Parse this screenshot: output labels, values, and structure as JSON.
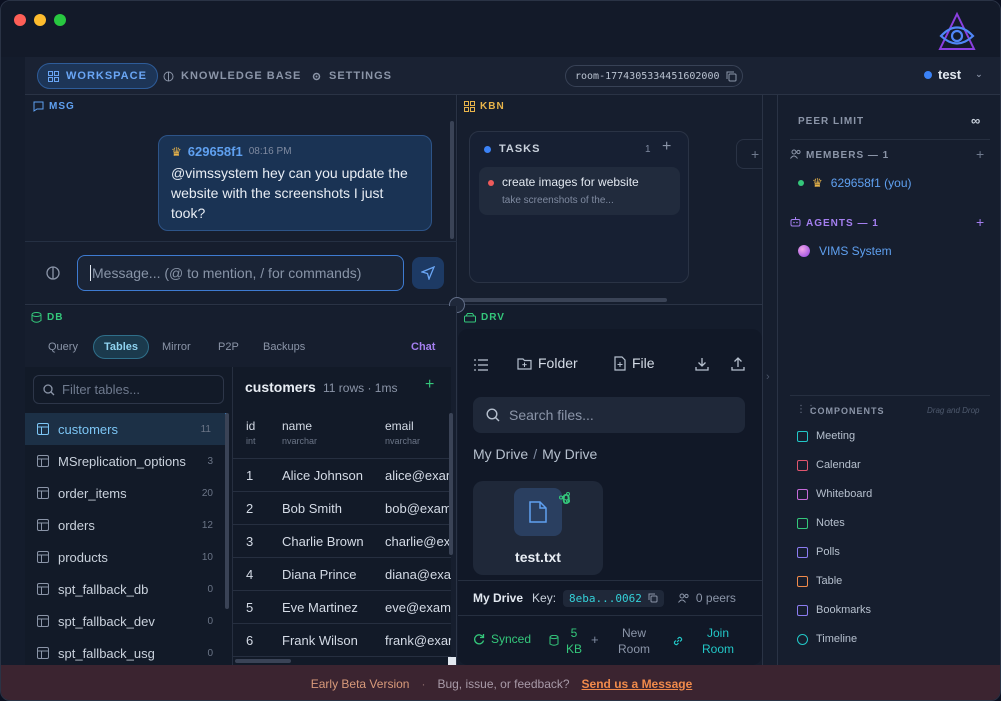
{
  "nav": {
    "workspace": "WORKSPACE",
    "knowledge": "KNOWLEDGE BASE",
    "settings": "SETTINGS",
    "room_id": "room-1774305334451602000",
    "user": "test"
  },
  "msg": {
    "header": "MSG",
    "author": "629658f1",
    "time": "08:16 PM",
    "text": "@vimssystem hey can you update the website with the screenshots I just took?",
    "placeholder": "Message... (@ to mention, / for commands)"
  },
  "kbn": {
    "header": "KBN",
    "column": "TASKS",
    "count": "1",
    "task_title": "create images for website",
    "task_desc": "take screenshots of the..."
  },
  "db": {
    "header": "DB",
    "tabs": [
      "Query",
      "Tables",
      "Mirror",
      "P2P",
      "Backups"
    ],
    "chat": "Chat",
    "filter_placeholder": "Filter tables...",
    "tables": [
      {
        "name": "customers",
        "count": "11"
      },
      {
        "name": "MSreplication_options",
        "count": "3"
      },
      {
        "name": "order_items",
        "count": "20"
      },
      {
        "name": "orders",
        "count": "12"
      },
      {
        "name": "products",
        "count": "10"
      },
      {
        "name": "spt_fallback_db",
        "count": "0"
      },
      {
        "name": "spt_fallback_dev",
        "count": "0"
      },
      {
        "name": "spt_fallback_usg",
        "count": "0"
      }
    ],
    "grid_title": "customers",
    "grid_meta": "11 rows · 1ms",
    "columns": [
      {
        "name": "id",
        "type": "int"
      },
      {
        "name": "name",
        "type": "nvarchar"
      },
      {
        "name": "email",
        "type": "nvarchar"
      }
    ],
    "rows": [
      [
        "1",
        "Alice Johnson",
        "alice@exan"
      ],
      [
        "2",
        "Bob Smith",
        "bob@exam"
      ],
      [
        "3",
        "Charlie Brown",
        "charlie@ex"
      ],
      [
        "4",
        "Diana Prince",
        "diana@exar"
      ],
      [
        "5",
        "Eve Martinez",
        "eve@examp"
      ],
      [
        "6",
        "Frank Wilson",
        "frank@exar"
      ]
    ]
  },
  "drv": {
    "header": "DRV",
    "folder": "Folder",
    "file": "File",
    "search_placeholder": "Search files...",
    "breadcrumb_root": "My Drive",
    "breadcrumb_sep": "/",
    "breadcrumb_current": "My Drive",
    "file_name": "test.txt",
    "share_count": "0",
    "drive_label": "My Drive",
    "key_label": "Key:",
    "key": "8eba...0062",
    "peers": "0 peers",
    "synced": "Synced",
    "size": "5",
    "size_unit": "KB",
    "new_room": "New",
    "new_room2": "Room",
    "join_room": "Join",
    "join_room2": "Room"
  },
  "right": {
    "peer_limit": "PEER LIMIT",
    "infinity": "∞",
    "members": "MEMBERS — 1",
    "member": "629658f1 (you)",
    "agents": "AGENTS — 1",
    "agent": "VIMS System",
    "components": "COMPONENTS",
    "drag": "Drag and Drop",
    "items": [
      "Meeting",
      "Calendar",
      "Whiteboard",
      "Notes",
      "Polls",
      "Table",
      "Bookmarks",
      "Timeline"
    ],
    "item_colors": [
      "#22c7c7",
      "#e0566f",
      "#c56bd9",
      "#34c77b",
      "#8b7cf0",
      "#f08a4b",
      "#8b7cf0",
      "#22c7c7"
    ]
  },
  "footer": {
    "beta": "Early Beta Version",
    "sep": "·",
    "question": "Bug, issue, or feedback?",
    "link": "Send us a Message"
  }
}
